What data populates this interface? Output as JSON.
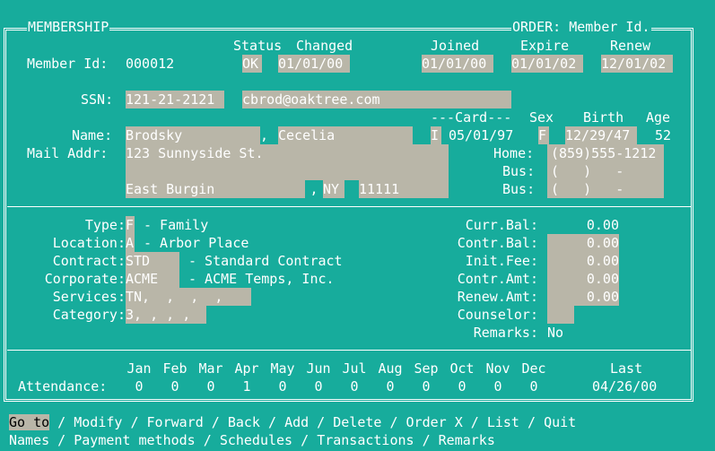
{
  "window": {
    "left_title": "MEMBERSHIP",
    "right_title": "ORDER: Member Id."
  },
  "header": {
    "member_id_label": "Member Id:",
    "member_id": "000012",
    "status_label": "Status",
    "changed_label": "Changed",
    "status": "OK",
    "changed": "01/01/00",
    "joined_label": "Joined",
    "expire_label": "Expire",
    "renew_label": "Renew",
    "joined": "01/01/00",
    "expire": "01/01/02",
    "renew": "12/01/02"
  },
  "contact": {
    "ssn_label": "SSN:",
    "ssn": "121-21-2121",
    "email": "cbrod@oaktree.com",
    "card_label": "---Card---",
    "sex_label": "Sex",
    "birth_label": "Birth",
    "age_label": "Age",
    "name_label": "Name:",
    "last_name": "Brodsky",
    "name_sep": ",",
    "first_name": "Cecelia",
    "card_type": "I",
    "card_date": "05/01/97",
    "sex": "F",
    "birth": "12/29/47",
    "age": "52",
    "mail_label": "Mail Addr:",
    "address1": "123 Sunnyside St.",
    "city": "East Burgin",
    "city_sep": ",",
    "state": "NY",
    "zip": "11111",
    "home_label": "Home:",
    "home_phone": "(859)555-1212",
    "bus_label": "Bus:",
    "bus_phone1": "(   )   -",
    "bus_phone2": "(   )   -"
  },
  "membership": {
    "type_label": "Type:",
    "type_code": "F",
    "type_desc": "- Family",
    "location_label": "Location:",
    "location_code": "A",
    "location_desc": "- Arbor Place",
    "contract_label": "Contract:",
    "contract_code": "STD",
    "contract_desc": "- Standard Contract",
    "corporate_label": "Corporate:",
    "corporate_code": "ACME",
    "corporate_desc": "- ACME Temps, Inc.",
    "services_label": "Services:",
    "services": "TN,  ,  ,  ,",
    "category_label": "Category:",
    "category": "3, , , ,"
  },
  "financial": {
    "curr_bal_label": "Curr.Bal:",
    "curr_bal": "0.00",
    "contr_bal_label": "Contr.Bal:",
    "contr_bal": "0.00",
    "init_fee_label": "Init.Fee:",
    "init_fee": "0.00",
    "contr_amt_label": "Contr.Amt:",
    "contr_amt": "0.00",
    "renew_amt_label": "Renew.Amt:",
    "renew_amt": "0.00",
    "counselor_label": "Counselor:",
    "counselor": "",
    "remarks_label": "Remarks:",
    "remarks": "No"
  },
  "attendance": {
    "label": "Attendance:",
    "months": [
      "Jan",
      "Feb",
      "Mar",
      "Apr",
      "May",
      "Jun",
      "Jul",
      "Aug",
      "Sep",
      "Oct",
      "Nov",
      "Dec"
    ],
    "values": [
      "0",
      "0",
      "0",
      "1",
      "0",
      "0",
      "0",
      "0",
      "0",
      "0",
      "0",
      "0"
    ],
    "last_label": "Last",
    "last": "04/26/00"
  },
  "menu": {
    "row1": [
      "Go to",
      "Modify",
      "Forward",
      "Back",
      "Add",
      "Delete",
      "Order X",
      "List",
      "Quit"
    ],
    "row2": [
      "Names",
      "Payment methods",
      "Schedules",
      "Transactions",
      "Remarks"
    ],
    "separator": " / "
  },
  "colors": {
    "background": "#17ac9c",
    "field": "#b9b6a8",
    "text": "#ffffff"
  }
}
